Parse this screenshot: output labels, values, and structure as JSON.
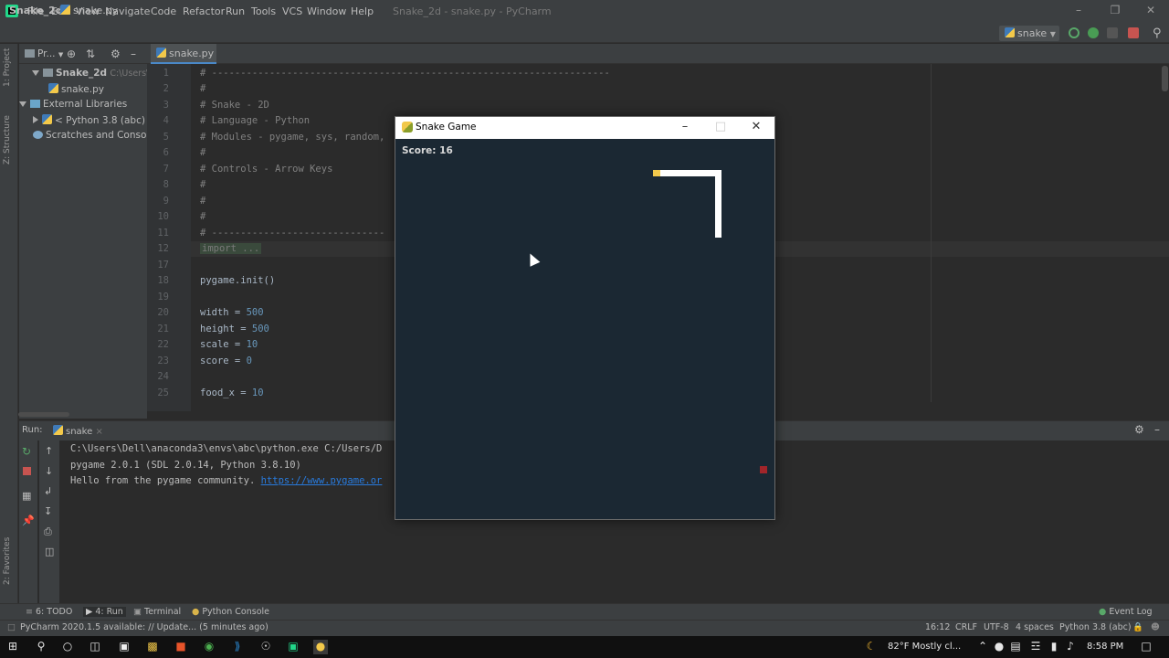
{
  "app": {
    "menu": [
      "File",
      "Edit",
      "View",
      "Navigate",
      "Code",
      "Refactor",
      "Run",
      "Tools",
      "VCS",
      "Window",
      "Help"
    ],
    "window_title": "Snake_2d - snake.py - PyCharm"
  },
  "navbar": {
    "project": "Snake_2d",
    "file": "snake.py",
    "run_config": "snake"
  },
  "project_panel": {
    "header": "Pr...",
    "root": "Snake_2d",
    "root_path": "C:\\Users\\Dell",
    "file": "snake.py",
    "external_libraries": "External Libraries",
    "python_sdk": "< Python 3.8 (abc) >",
    "scratches": "Scratches and Consoles"
  },
  "left_stripe": {
    "project": "1: Project",
    "structure": "Z: Structure",
    "favorites": "2: Favorites"
  },
  "editor": {
    "tab": "snake.py",
    "lines": [
      {
        "n": "1",
        "text": "# ---------------------------------------------------------------------"
      },
      {
        "n": "2",
        "text": "#"
      },
      {
        "n": "3",
        "text": "# Snake - 2D"
      },
      {
        "n": "4",
        "text": "# Language - Python"
      },
      {
        "n": "5",
        "text": "# Modules - pygame, sys, random,"
      },
      {
        "n": "6",
        "text": "#"
      },
      {
        "n": "7",
        "text": "# Controls - Arrow Keys"
      },
      {
        "n": "8",
        "text": "#"
      },
      {
        "n": "9",
        "text": "#"
      },
      {
        "n": "10",
        "text": "#"
      },
      {
        "n": "11",
        "text": "# ------------------------------"
      },
      {
        "n": "12",
        "text": "import ..."
      },
      {
        "n": "17",
        "text": ""
      },
      {
        "n": "18",
        "text": "pygame.init()"
      },
      {
        "n": "19",
        "text": ""
      },
      {
        "n": "20",
        "code": "width = ",
        "value": "500"
      },
      {
        "n": "21",
        "code": "height = ",
        "value": "500"
      },
      {
        "n": "22",
        "code": "scale = ",
        "value": "10"
      },
      {
        "n": "23",
        "code": "score = ",
        "value": "0"
      },
      {
        "n": "24",
        "text": ""
      },
      {
        "n": "25",
        "code": "food_x = ",
        "value": "10"
      }
    ]
  },
  "run_panel": {
    "label": "Run:",
    "tab": "snake",
    "output": [
      "C:\\Users\\Dell\\anaconda3\\envs\\abc\\python.exe C:/Users/D",
      "pygame 2.0.1 (SDL 2.0.14, Python 3.8.10)",
      "Hello from the pygame community. "
    ],
    "link": "https://www.pygame.or"
  },
  "bottom_tabs": {
    "todo": "6: TODO",
    "run": "4: Run",
    "terminal": "Terminal",
    "python_console": "Python Console",
    "event_log": "Event Log"
  },
  "status": {
    "message": "PyCharm 2020.1.5 available: // Update... (5 minutes ago)",
    "position": "16:12",
    "line_sep": "CRLF",
    "encoding": "UTF-8",
    "indent": "4 spaces",
    "interpreter": "Python 3.8 (abc)"
  },
  "game": {
    "title": "Snake Game",
    "score": "Score: 16",
    "colors": {
      "background": "#1b2833",
      "snake": "#ffffff",
      "head": "#f2c94c",
      "food": "#a1252a"
    }
  },
  "taskbar": {
    "weather": "82°F  Mostly cl...",
    "time": "8:58 PM"
  }
}
